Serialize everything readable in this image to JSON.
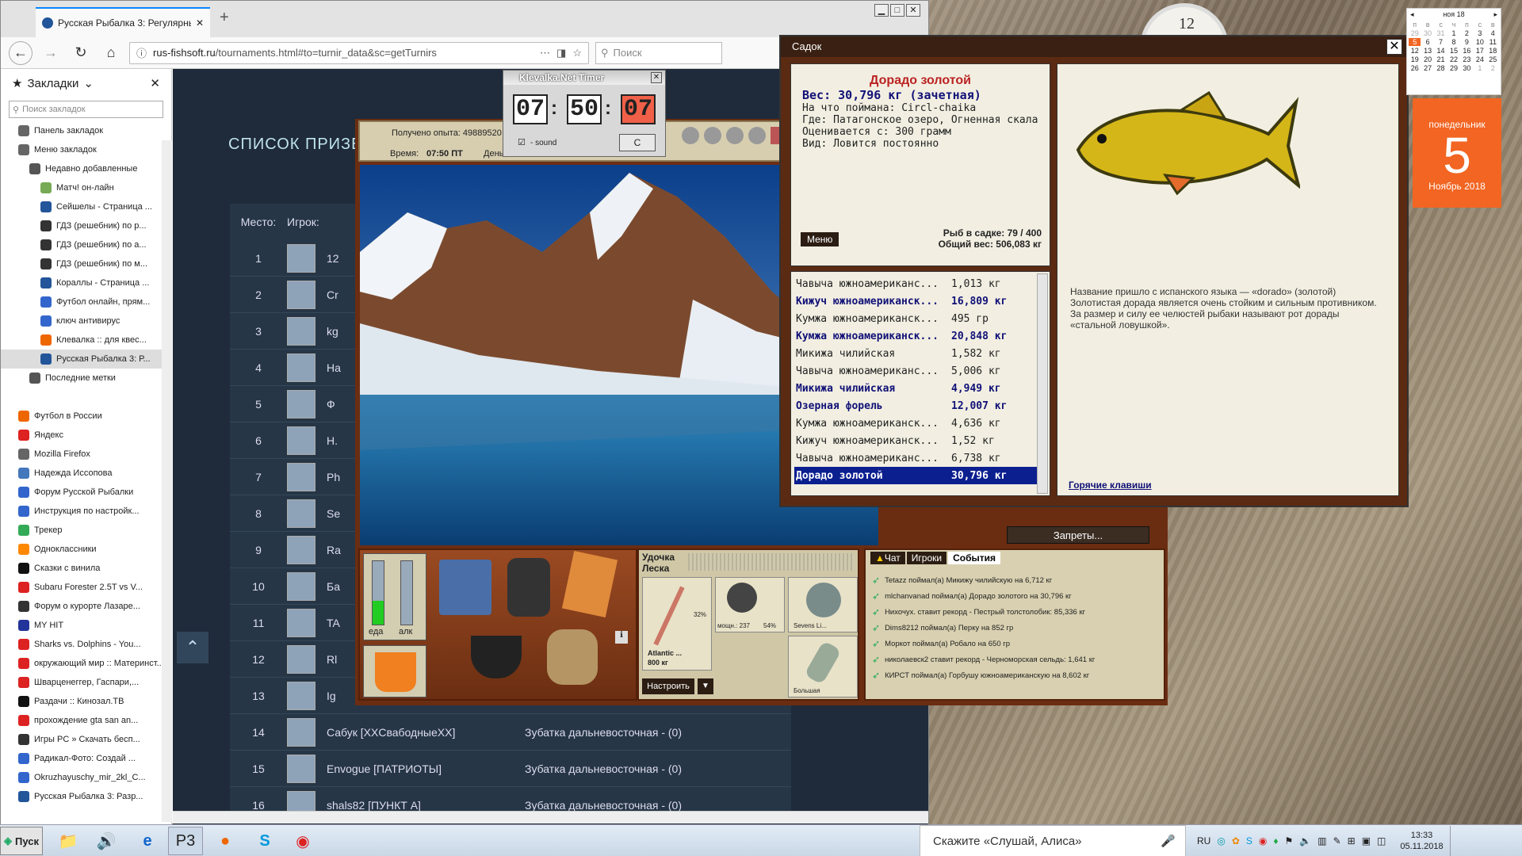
{
  "browser": {
    "tab_title": "Русская Рыбалка 3: Регулярные",
    "new_tab": "+",
    "url_domain": "rus-fishsoft.ru",
    "url_path": "/tournaments.html#to=turnir_data&sc=getTurnirs",
    "search_placeholder": "Поиск"
  },
  "sidebar": {
    "title": "Закладки",
    "search_placeholder": "Поиск закладок",
    "items": [
      {
        "label": "Панель закладок",
        "indent": 1,
        "color": "#666"
      },
      {
        "label": "Меню закладок",
        "indent": 1,
        "color": "#666"
      },
      {
        "label": "Недавно добавленные",
        "indent": 2,
        "color": "#555"
      },
      {
        "label": "Матч! он-лайн",
        "indent": 3,
        "color": "#7a5"
      },
      {
        "label": "Сейшелы - Страница ...",
        "indent": 3,
        "color": "#259"
      },
      {
        "label": "ГДЗ (решебник) по р...",
        "indent": 3,
        "color": "#333"
      },
      {
        "label": "ГДЗ (решебник) по а...",
        "indent": 3,
        "color": "#333"
      },
      {
        "label": "ГДЗ (решебник) по м...",
        "indent": 3,
        "color": "#333"
      },
      {
        "label": "Кораллы - Страница ...",
        "indent": 3,
        "color": "#259"
      },
      {
        "label": "Футбол онлайн, прям...",
        "indent": 3,
        "color": "#36c"
      },
      {
        "label": "ключ антивирус",
        "indent": 3,
        "color": "#36c"
      },
      {
        "label": "Клевалка :: для квес...",
        "indent": 3,
        "color": "#e60"
      },
      {
        "label": "Русская Рыбалка 3: Р...",
        "indent": 3,
        "color": "#259",
        "selected": true
      },
      {
        "label": "Последние метки",
        "indent": 2,
        "color": "#555"
      },
      {
        "label": "",
        "indent": 0,
        "color": "transparent"
      },
      {
        "label": "Футбол в России",
        "indent": 1,
        "color": "#e60"
      },
      {
        "label": "Яндекс",
        "indent": 1,
        "color": "#d22"
      },
      {
        "label": "Mozilla Firefox",
        "indent": 1,
        "color": "#666"
      },
      {
        "label": "Надежда Иссопова",
        "indent": 1,
        "color": "#47b"
      },
      {
        "label": "Форум Русской Рыбалки",
        "indent": 1,
        "color": "#36c"
      },
      {
        "label": "Инструкция по настройк...",
        "indent": 1,
        "color": "#36c"
      },
      {
        "label": "Трекер",
        "indent": 1,
        "color": "#3a5"
      },
      {
        "label": "Одноклассники",
        "indent": 1,
        "color": "#f80"
      },
      {
        "label": "Сказки с винила",
        "indent": 1,
        "color": "#111"
      },
      {
        "label": "Subaru Forester 2.5T vs V...",
        "indent": 1,
        "color": "#d22"
      },
      {
        "label": "Форум о курорте Лазаре...",
        "indent": 1,
        "color": "#333"
      },
      {
        "label": "MY HIT",
        "indent": 1,
        "color": "#239"
      },
      {
        "label": "Sharks vs. Dolphins - You...",
        "indent": 1,
        "color": "#d22"
      },
      {
        "label": "окружающий мир :: Материнст...",
        "indent": 1,
        "color": "#d22"
      },
      {
        "label": "Шварценеггер, Гаспари,...",
        "indent": 1,
        "color": "#d22"
      },
      {
        "label": "Раздачи :: Кинозал.ТВ",
        "indent": 1,
        "color": "#111"
      },
      {
        "label": "прохождение gta san an...",
        "indent": 1,
        "color": "#d22"
      },
      {
        "label": "Игры PC » Скачать бесп...",
        "indent": 1,
        "color": "#333"
      },
      {
        "label": "Радикал-Фото: Создай ...",
        "indent": 1,
        "color": "#36c"
      },
      {
        "label": "Okruzhayuschy_mir_2kl_C...",
        "indent": 1,
        "color": "#36c"
      },
      {
        "label": "Русская Рыбалка 3: Разр...",
        "indent": 1,
        "color": "#259"
      }
    ]
  },
  "page": {
    "heading": "СПИСОК ПРИЗЕР",
    "col_place": "Место:",
    "col_player": "Игрок:",
    "rows": [
      {
        "place": "1",
        "name": "12",
        "fish": ""
      },
      {
        "place": "2",
        "name": "Cr",
        "fish": ""
      },
      {
        "place": "3",
        "name": "kg",
        "fish": ""
      },
      {
        "place": "4",
        "name": "Ha",
        "fish": ""
      },
      {
        "place": "5",
        "name": "Ф",
        "fish": ""
      },
      {
        "place": "6",
        "name": "H.",
        "fish": ""
      },
      {
        "place": "7",
        "name": "Ph",
        "fish": ""
      },
      {
        "place": "8",
        "name": "Se",
        "fish": ""
      },
      {
        "place": "9",
        "name": "Ra",
        "fish": ""
      },
      {
        "place": "10",
        "name": "Ба",
        "fish": ""
      },
      {
        "place": "11",
        "name": "TA",
        "fish": ""
      },
      {
        "place": "12",
        "name": "Rl",
        "fish": ""
      },
      {
        "place": "13",
        "name": "Ig",
        "fish": ""
      },
      {
        "place": "14",
        "name": "Сабук [XXСвабодныеXX]",
        "fish": "Зубатка дальневосточная - (0)"
      },
      {
        "place": "15",
        "name": "Envogue [ПАТРИОТЫ]",
        "fish": "Зубатка дальневосточная - (0)"
      },
      {
        "place": "16",
        "name": "shals82 [ПУНКТ А]",
        "fish": "Зубатка дальневосточная - (0)"
      }
    ]
  },
  "game": {
    "exp_label": "Получено опыта: 49889520",
    "time_label": "Время:",
    "time_value": "07:50 ПТ",
    "days_label": "Дены",
    "food_label": "еда",
    "alc_label": "алк",
    "rod_label": "Удочка",
    "line_label": "Леска",
    "rod_name": "Atlantic ...",
    "rod_weight": "800 кг",
    "rod_pct": "32%",
    "reel_info": "мощн.: 237",
    "reel_pct": "54%",
    "line_name": "Sevens Li...",
    "lure_name": "Большая",
    "setup_btn": "Настроить",
    "bans_btn": "Запреты...",
    "events_tabs": [
      "Чат",
      "Игроки",
      "События"
    ],
    "events": [
      "Tetazz поймал(а) Микижу чилийскую на 6,712 кг",
      "mlchanvanad поймал(а) Дорадо золотого на 30,796 кг",
      "Нихочух. ставит рекорд - Пестрый толстолобик: 85,336 кг",
      "Dims8212 поймал(а) Перку на 852 гр",
      "Моркот поймал(а) Робало на 650 гр",
      "николаевск2 ставит рекорд - Черноморская сельдь: 1,641 кг",
      "КИРСТ поймал(а) Горбушу южноамериканскую на 8,602 кг"
    ]
  },
  "timer": {
    "title": "Klevalka.Net Timer",
    "hh": "07",
    "mm": "50",
    "ss": "07",
    "sound_label": "- sound",
    "c_btn": "C"
  },
  "sadok": {
    "title": "Садок",
    "fish_name": "Дорадо золотой",
    "weight": "Вес: 30,796 кг (зачетная)",
    "bait": "На что поймана: Circl-chaika",
    "where": "Где: Патагонское озеро, Огненная скала",
    "rated": "Оценивается с: 300 грамм",
    "kind": "Вид: Ловится постоянно",
    "menu_btn": "Меню",
    "count": "Рыб в садке: 79 / 400",
    "total": "Общий вес: 506,083 кг",
    "list": [
      {
        "name": "Чавыча южноамериканс...",
        "w": "1,013 кг",
        "style": ""
      },
      {
        "name": "Кижуч южноамериканск...",
        "w": "16,809 кг",
        "style": "b"
      },
      {
        "name": "Кумжа южноамериканск...",
        "w": "495 гр",
        "style": ""
      },
      {
        "name": "Кумжа южноамериканск...",
        "w": "20,848 кг",
        "style": "b"
      },
      {
        "name": "Микижа чилийская",
        "w": "1,582 кг",
        "style": ""
      },
      {
        "name": "Чавыча южноамериканс...",
        "w": "5,006 кг",
        "style": ""
      },
      {
        "name": "Микижа чилийская",
        "w": "4,949 кг",
        "style": "b"
      },
      {
        "name": "Озерная форель",
        "w": "12,007 кг",
        "style": "b"
      },
      {
        "name": "Кумжа южноамериканск...",
        "w": "4,636 кг",
        "style": ""
      },
      {
        "name": "Кижуч южноамериканск...",
        "w": "1,52 кг",
        "style": ""
      },
      {
        "name": "Чавыча южноамериканс...",
        "w": "6,738 кг",
        "style": ""
      },
      {
        "name": "Дорадо золотой",
        "w": "30,796 кг",
        "style": "s"
      }
    ],
    "description": "Название пришло с испанского языка — «dorado» (золотой) Золотистая дорада является очень стойким и сильным противником. За размер и силу ее челюстей рыбаки называют рот дорады «стальной ловушкой».",
    "hotkeys": "Горячие клавиши"
  },
  "desktop": {
    "clock_num": "12",
    "cal_month": "ноя 18",
    "cal_days": [
      "п",
      "в",
      "с",
      "ч",
      "п",
      "с",
      "в"
    ],
    "cal_rows": [
      [
        "29",
        "30",
        "31",
        "1",
        "2",
        "3",
        "4"
      ],
      [
        "5",
        "6",
        "7",
        "8",
        "9",
        "10",
        "11"
      ],
      [
        "12",
        "13",
        "14",
        "15",
        "16",
        "17",
        "18"
      ],
      [
        "19",
        "20",
        "21",
        "22",
        "23",
        "24",
        "25"
      ],
      [
        "26",
        "27",
        "28",
        "29",
        "30",
        "1",
        "2"
      ]
    ],
    "weekday": "понедельник",
    "day": "5",
    "month_year": "Ноябрь 2018"
  },
  "taskbar": {
    "start": "Пуск",
    "alice": "Скажите «Слушай, Алиса»",
    "lang": "RU",
    "time": "13:33",
    "date": "05.11.2018"
  }
}
